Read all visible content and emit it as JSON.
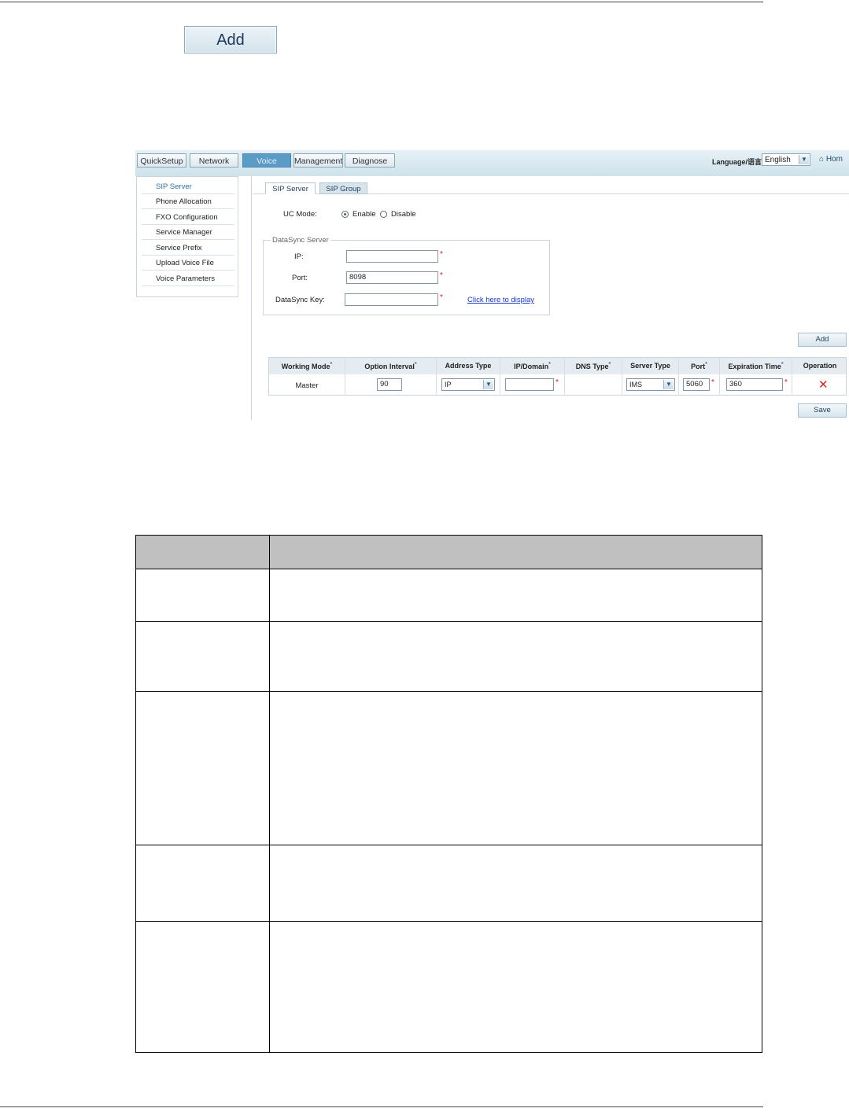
{
  "page": {
    "add_button_label": "Add"
  },
  "screenshot": {
    "nav_tabs": [
      "QuickSetup",
      "Network",
      "Voice",
      "Management",
      "Diagnose"
    ],
    "active_nav": "Voice",
    "language_label": "Language/语言:",
    "language_value": "English",
    "home_label": "Hom",
    "sidebar": [
      "SIP Server",
      "Phone Allocation",
      "FXO Configuration",
      "Service Manager",
      "Service Prefix",
      "Upload Voice File",
      "Voice Parameters"
    ],
    "active_sidebar": "SIP Server",
    "subtabs": [
      "SIP Server",
      "SIP Group"
    ],
    "uc_mode": {
      "label": "UC Mode:",
      "options": [
        "Enable",
        "Disable"
      ],
      "selected": "Enable"
    },
    "datasync": {
      "legend": "DataSync Server",
      "ip_label": "IP:",
      "ip_value": "",
      "port_label": "Port:",
      "port_value": "8098",
      "key_label": "DataSync Key:",
      "key_value": "",
      "display_link": "Click here to display"
    },
    "add_label": "Add",
    "save_label": "Save",
    "table": {
      "headers": [
        "Working Mode",
        "Option Interval",
        "Address Type",
        "IP/Domain",
        "DNS Type",
        "Server Type",
        "Port",
        "Expiration Time",
        "Operation"
      ],
      "row": {
        "working_mode": "Master",
        "option_interval": "90",
        "address_type": "IP",
        "ip_domain": "",
        "dns_type": "",
        "server_type": "IMS",
        "port": "5060",
        "expiration_time": "360"
      }
    }
  },
  "colors": {
    "active_tab": "#5a9cc6",
    "required": "#d02020",
    "delete": "#d8261c",
    "table_header": "#c0c0c0"
  }
}
